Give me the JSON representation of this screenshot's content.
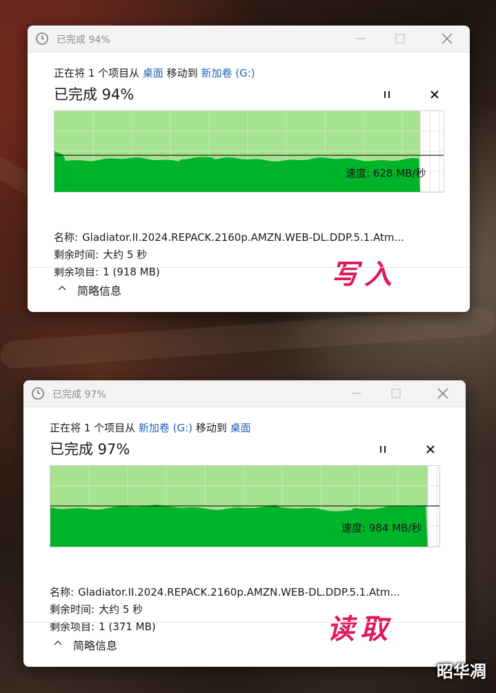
{
  "dialogs": [
    {
      "title": "已完成 94%",
      "moving_prefix": "正在将 1 个项目从",
      "source": "桌面",
      "moving_mid": "移动到",
      "dest": "新加卷 (G:)",
      "percent_text": "已完成 94%",
      "progress": 0.94,
      "speed_text": "速度: 628 MB/秒",
      "name_label": "名称:",
      "name_value": "Gladiator.II.2024.REPACK.2160p.AMZN.WEB-DL.DDP.5.1.Atm...",
      "time_label": "剩余时间:",
      "time_value": "大约 5 秒",
      "items_label": "剩余项目:",
      "items_value": "1 (918 MB)",
      "annotation": "写入",
      "footer_label": "简略信息"
    },
    {
      "title": "已完成 97%",
      "moving_prefix": "正在将 1 个项目从",
      "source": "新加卷 (G:)",
      "moving_mid": "移动到",
      "dest": "桌面",
      "percent_text": "已完成 97%",
      "progress": 0.97,
      "speed_text": "速度: 984 MB/秒",
      "name_label": "名称:",
      "name_value": "Gladiator.II.2024.REPACK.2160p.AMZN.WEB-DL.DDP.5.1.Atm...",
      "time_label": "剩余时间:",
      "time_value": "大约 5 秒",
      "items_label": "剩余项目:",
      "items_value": "1 (371 MB)",
      "annotation": "读取",
      "footer_label": "简略信息"
    }
  ],
  "watermark": "昭华凋",
  "colors": {
    "graph_fill": "#00b42a",
    "graph_light": "#a6e28f",
    "graph_grid": "#d0d0d0",
    "link": "#1f63b5",
    "annotation": "#e0195a"
  },
  "icons": {
    "title": "clock-icon",
    "minimize": "minimize-icon",
    "maximize": "maximize-icon",
    "close": "close-icon",
    "pause": "pause-icon",
    "cancel": "cancel-icon",
    "chevron": "chevron-up-icon"
  }
}
